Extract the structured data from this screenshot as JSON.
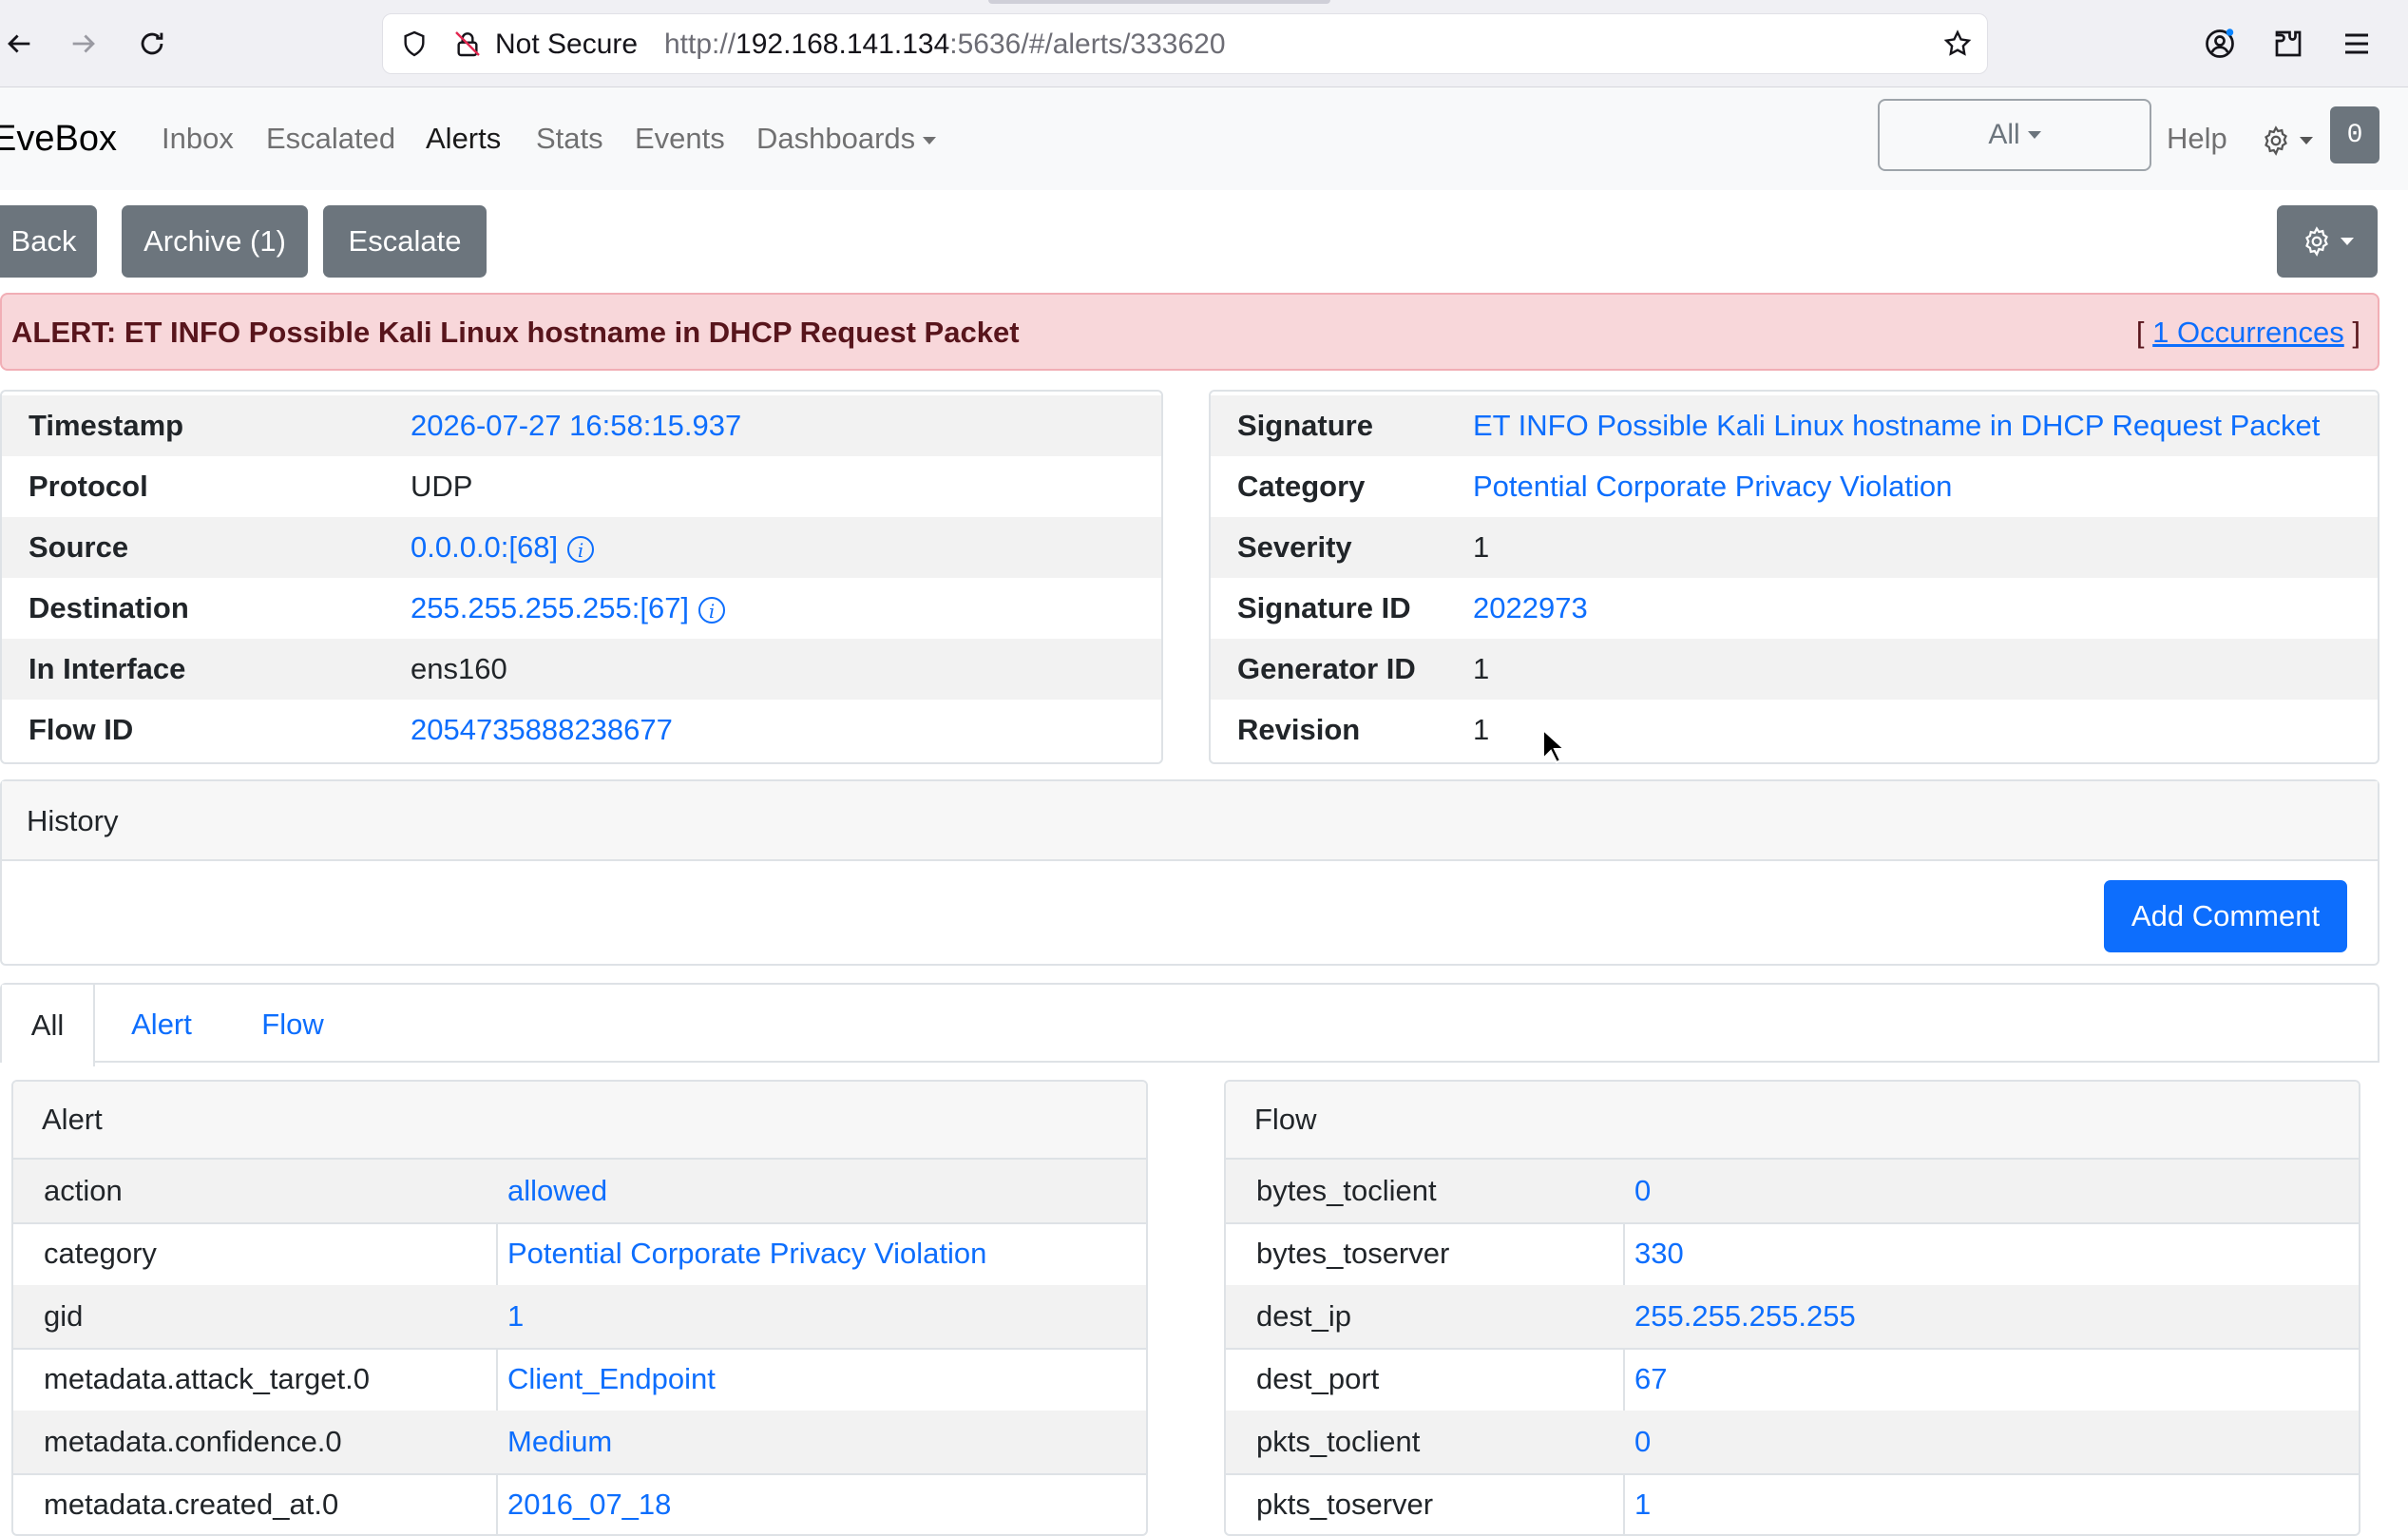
{
  "browser": {
    "not_secure_label": "Not Secure",
    "url_prefix": "http://",
    "url_host": "192.168.141.134",
    "url_rest": ":5636/#/alerts/333620"
  },
  "navbar": {
    "brand": "EveBox",
    "links": {
      "inbox": "Inbox",
      "escalated": "Escalated",
      "alerts": "Alerts",
      "stats": "Stats",
      "events": "Events",
      "dashboards": "Dashboards"
    },
    "filter_value": "All",
    "help": "Help",
    "badge_count": "0"
  },
  "actions": {
    "back": "Back",
    "archive": "Archive (1)",
    "escalate": "Escalate"
  },
  "alert_banner": {
    "title": "ALERT: ET INFO Possible Kali Linux hostname in DHCP Request Packet",
    "occ_open": "[",
    "occ_link": "1 Occurrences",
    "occ_close": "]"
  },
  "left_info": {
    "timestamp_label": "Timestamp",
    "timestamp": "2026-07-27 16:58:15.937",
    "protocol_label": "Protocol",
    "protocol": "UDP",
    "source_label": "Source",
    "source": "0.0.0.0:[68]",
    "destination_label": "Destination",
    "destination": "255.255.255.255:[67]",
    "in_interface_label": "In Interface",
    "in_interface": "ens160",
    "flow_id_label": "Flow ID",
    "flow_id": "2054735888238677"
  },
  "right_info": {
    "signature_label": "Signature",
    "signature": "ET INFO Possible Kali Linux hostname in DHCP Request Packet",
    "category_label": "Category",
    "category": "Potential Corporate Privacy Violation",
    "severity_label": "Severity",
    "severity": "1",
    "signature_id_label": "Signature ID",
    "signature_id": "2022973",
    "generator_id_label": "Generator ID",
    "generator_id": "1",
    "revision_label": "Revision",
    "revision": "1"
  },
  "history": {
    "title": "History",
    "add_comment": "Add Comment"
  },
  "tabs": {
    "all": "All",
    "alert": "Alert",
    "flow": "Flow"
  },
  "alert_card": {
    "title": "Alert",
    "rows": [
      {
        "key": "action",
        "value": "allowed"
      },
      {
        "key": "category",
        "value": "Potential Corporate Privacy Violation"
      },
      {
        "key": "gid",
        "value": "1"
      },
      {
        "key": "metadata.attack_target.0",
        "value": "Client_Endpoint"
      },
      {
        "key": "metadata.confidence.0",
        "value": "Medium"
      },
      {
        "key": "metadata.created_at.0",
        "value": "2016_07_18"
      }
    ]
  },
  "flow_card": {
    "title": "Flow",
    "rows": [
      {
        "key": "bytes_toclient",
        "value": "0"
      },
      {
        "key": "bytes_toserver",
        "value": "330"
      },
      {
        "key": "dest_ip",
        "value": "255.255.255.255"
      },
      {
        "key": "dest_port",
        "value": "67"
      },
      {
        "key": "pkts_toclient",
        "value": "0"
      },
      {
        "key": "pkts_toserver",
        "value": "1"
      }
    ]
  },
  "colors": {
    "link": "#0d6efd",
    "secondary_button": "#6c757d",
    "alert_bg": "#f8d7da",
    "alert_text": "#58151c"
  }
}
